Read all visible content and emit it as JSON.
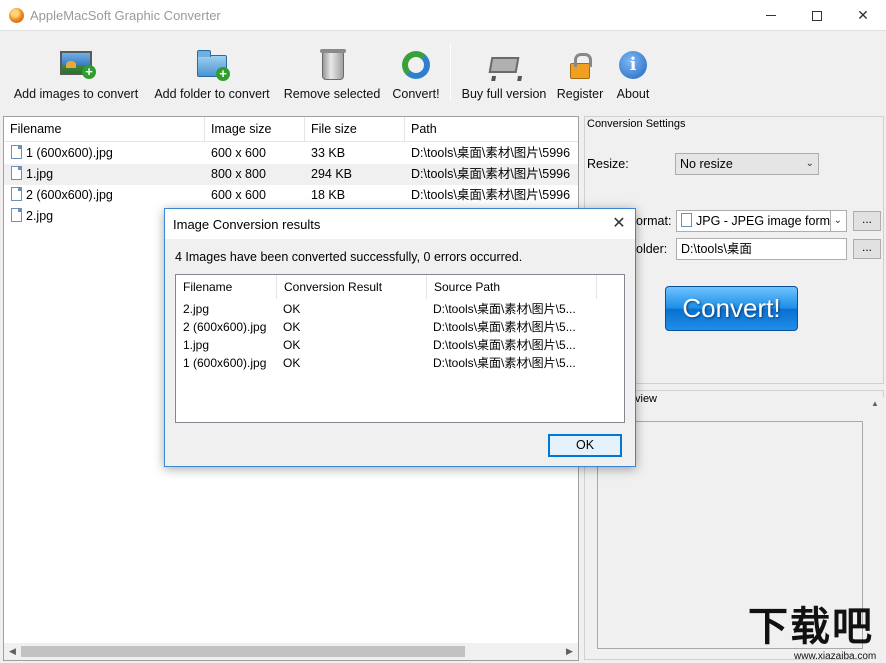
{
  "window": {
    "title": "AppleMacSoft Graphic Converter",
    "min_glyph": "",
    "max_glyph": "",
    "close_glyph": "✕"
  },
  "toolbar": {
    "add_images": "Add images to convert",
    "add_folder": "Add folder to convert",
    "remove_selected": "Remove selected",
    "convert": "Convert!",
    "buy": "Buy full version",
    "register": "Register",
    "about": "About"
  },
  "filelist": {
    "columns": [
      "Filename",
      "Image size",
      "File size",
      "Path"
    ],
    "rows": [
      {
        "name": "1 (600x600).jpg",
        "size": "600 x 600",
        "filesize": "33 KB",
        "path": "D:\\tools\\桌面\\素材\\图片\\5996"
      },
      {
        "name": "1.jpg",
        "size": "800 x 800",
        "filesize": "294 KB",
        "path": "D:\\tools\\桌面\\素材\\图片\\5996"
      },
      {
        "name": "2 (600x600).jpg",
        "size": "600 x 600",
        "filesize": "18 KB",
        "path": "D:\\tools\\桌面\\素材\\图片\\5996"
      },
      {
        "name": "2.jpg",
        "size": "",
        "filesize": "",
        "path": ""
      }
    ]
  },
  "settings": {
    "group_title": "Conversion Settings",
    "resize_label": "Resize:",
    "resize_value": "No resize",
    "format_label": "ormat:",
    "format_value": "JPG - JPEG image form",
    "folder_label": "older:",
    "folder_value": "D:\\tools\\桌面",
    "browse": "...",
    "convert_button": "Convert!"
  },
  "preview": {
    "title": "view"
  },
  "dialog": {
    "title": "Image Conversion results",
    "close": "✕",
    "message": "4 Images have been converted successfully, 0 errors occurred.",
    "columns": [
      "Filename",
      "Conversion Result",
      "Source Path"
    ],
    "rows": [
      {
        "file": "2.jpg",
        "result": "OK",
        "path": "D:\\tools\\桌面\\素材\\图片\\5..."
      },
      {
        "file": "2 (600x600).jpg",
        "result": "OK",
        "path": "D:\\tools\\桌面\\素材\\图片\\5..."
      },
      {
        "file": "1.jpg",
        "result": "OK",
        "path": "D:\\tools\\桌面\\素材\\图片\\5..."
      },
      {
        "file": "1 (600x600).jpg",
        "result": "OK",
        "path": "D:\\tools\\桌面\\素材\\图片\\5..."
      }
    ],
    "ok": "OK"
  },
  "watermark": {
    "main": "下载吧",
    "sub": "www.xiazaiba.com"
  },
  "icons": {
    "app": "app-icon",
    "add_images": "add-images-icon",
    "add_folder": "add-folder-icon",
    "remove": "trash-bin-icon",
    "convert": "recycle-arrows-icon",
    "buy": "shopping-cart-icon",
    "register": "padlock-icon",
    "about": "info-icon"
  }
}
